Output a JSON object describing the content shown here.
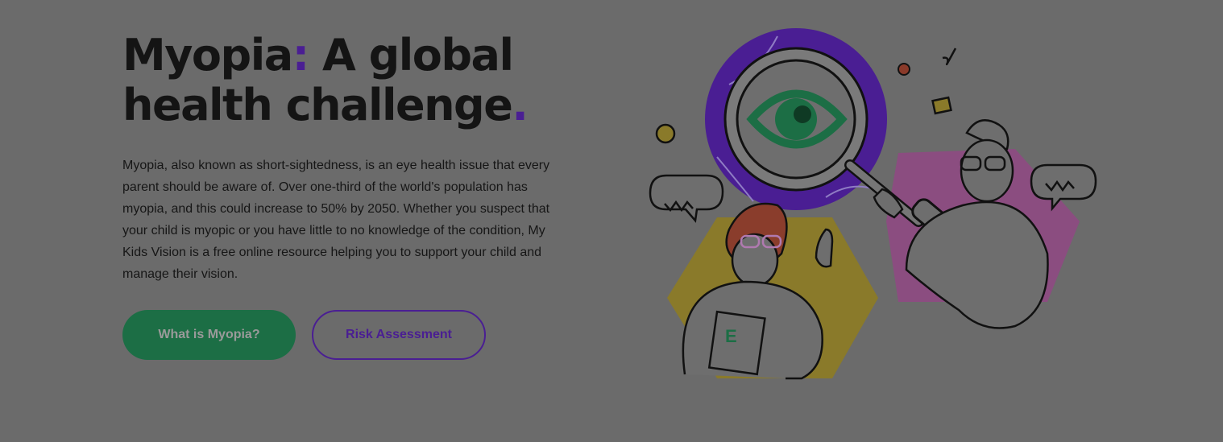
{
  "hero": {
    "title_part1": "Myopia",
    "title_colon": ":",
    "title_part2": " A global health challenge",
    "title_period": ".",
    "description": "Myopia, also known as short-sightedness, is an eye health issue that every parent should be aware of. Over one-third of the world's population has myopia, and this could increase to 50% by 2050. Whether you suspect that your child is myopic or you have little to no knowledge of the condition, My Kids Vision is a free online resource helping you to support your child and manage their vision."
  },
  "buttons": {
    "primary_label": "What is Myopia?",
    "secondary_label": "Risk Assessment"
  },
  "colors": {
    "background": "#6b6b6b",
    "accent_purple": "#4a1e93",
    "primary_green": "#1c6e45",
    "hex_yellow": "#8a7a2a",
    "hex_pink": "#8b4d80"
  },
  "illustration": {
    "icons": [
      "magnifying-glass-icon",
      "eye-icon",
      "speech-bubble-icon"
    ]
  }
}
